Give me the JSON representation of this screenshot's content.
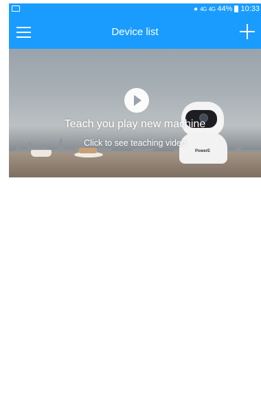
{
  "status_bar": {
    "left_icon": "image-notification-icon",
    "network": "4G",
    "signal": "4G",
    "battery_percent": "44%",
    "time": "10:33"
  },
  "title_bar": {
    "title": "Device list",
    "menu_icon": "menu-icon",
    "add_icon": "plus-icon"
  },
  "banner": {
    "title": "Teach you play new machine",
    "subtitle": "Click to see teaching video",
    "play_icon": "play-icon",
    "camera_brand": "PowerE"
  },
  "colors": {
    "accent": "#1a9cff",
    "background": "#ffffff"
  }
}
